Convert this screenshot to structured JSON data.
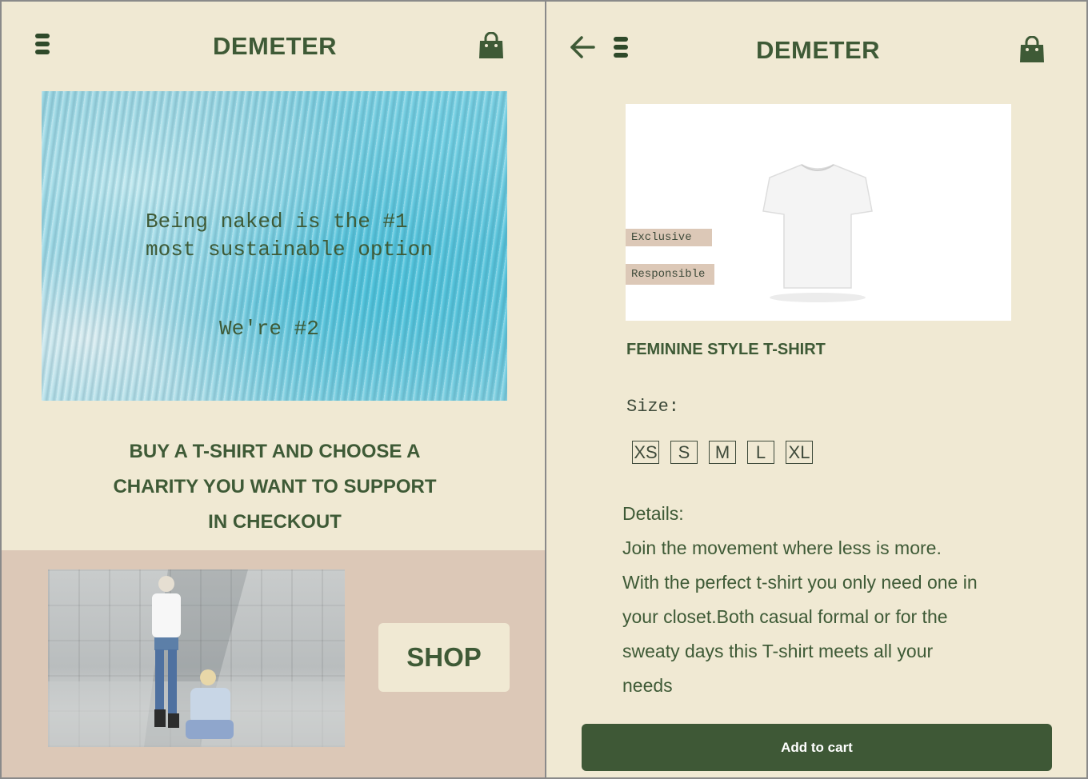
{
  "home": {
    "brand": "DEMETER",
    "hero": {
      "line1": "Being naked is the #1",
      "line2": "most sustainable option",
      "line3": "We're #2"
    },
    "promo": {
      "line1": "BUY A T-SHIRT AND CHOOSE A",
      "line2": "CHARITY YOU WANT TO SUPPORT",
      "line3": "IN CHECKOUT"
    },
    "shop_label": "SHOP"
  },
  "product": {
    "brand": "DEMETER",
    "tags": [
      "Exclusive",
      "Responsible"
    ],
    "title": "FEMININE STYLE T-SHIRT",
    "size_label": "Size:",
    "sizes": [
      "XS",
      "S",
      "M",
      "L",
      "XL"
    ],
    "details_heading": "Details:",
    "details_lines": [
      "Join the movement where less is more.",
      "With the perfect t-shirt you only need one in",
      "your closet.Both casual formal or for the",
      "sweaty days this T-shirt meets all your",
      "needs"
    ],
    "add_to_cart_label": "Add to cart"
  },
  "colors": {
    "background": "#f0e9d3",
    "accent_green": "#3e5836",
    "band_tan": "#dcc8b7"
  },
  "icons": {
    "menu": "menu-icon",
    "bag": "shopping-bag-icon",
    "back": "back-arrow-icon"
  }
}
